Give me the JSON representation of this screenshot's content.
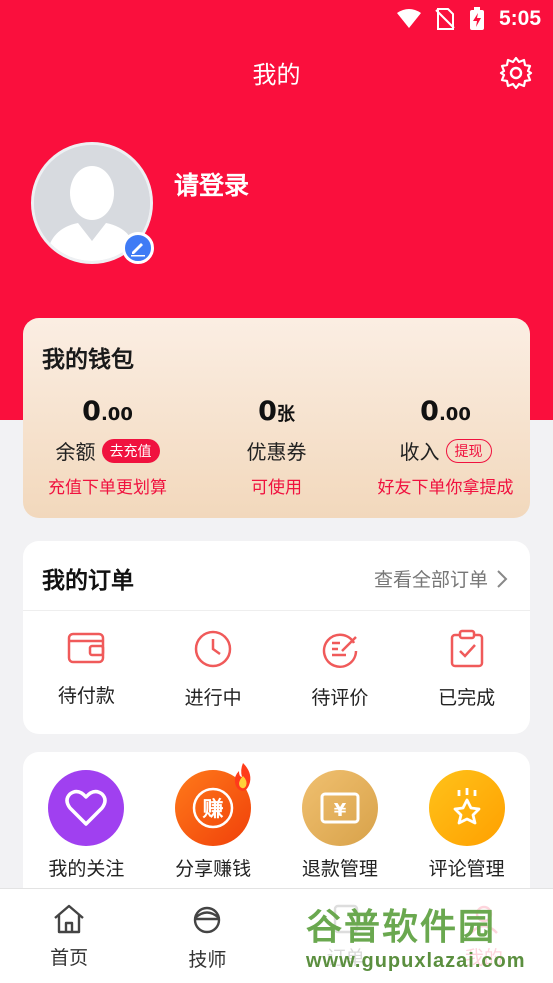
{
  "status": {
    "time": "5:05"
  },
  "header": {
    "title": "我的"
  },
  "profile": {
    "login_text": "请登录"
  },
  "wallet": {
    "title": "我的钱包",
    "balance": {
      "amount_int": "0",
      "amount_dec": ".00",
      "label": "余额",
      "action": "去充值",
      "sub": "充值下单更划算"
    },
    "coupon": {
      "amount_int": "0",
      "amount_unit": "张",
      "label": "优惠券",
      "sub": "可使用"
    },
    "income": {
      "amount_int": "0",
      "amount_dec": ".00",
      "label": "收入",
      "action": "提现",
      "sub": "好友下单你拿提成"
    }
  },
  "orders": {
    "title": "我的订单",
    "view_all": "查看全部订单",
    "items": [
      {
        "label": "待付款",
        "icon": "wallet-icon"
      },
      {
        "label": "进行中",
        "icon": "clock-icon"
      },
      {
        "label": "待评价",
        "icon": "review-icon"
      },
      {
        "label": "已完成",
        "icon": "clipboard-check-icon"
      }
    ]
  },
  "services": {
    "items": [
      {
        "label": "我的关注",
        "icon": "heart-icon",
        "color": "#a040f0"
      },
      {
        "label": "分享赚钱",
        "icon": "earn-icon",
        "glyph": "赚",
        "color": "#fa5a14"
      },
      {
        "label": "退款管理",
        "icon": "refund-icon",
        "glyph": "¥",
        "color": "#e0b060"
      },
      {
        "label": "评论管理",
        "icon": "star-icon",
        "color": "#ffb400"
      }
    ]
  },
  "tabbar": {
    "items": [
      {
        "label": "首页",
        "icon": "home-icon"
      },
      {
        "label": "技师",
        "icon": "technician-icon"
      },
      {
        "label": "订单",
        "icon": "order-icon"
      },
      {
        "label": "我的",
        "icon": "profile-icon"
      }
    ]
  },
  "watermark": {
    "main": "谷普软件园",
    "url": "www.gupuxlazai.com"
  },
  "colors": {
    "brand_red": "#fa0f3d",
    "accent_red": "#f0123f"
  }
}
